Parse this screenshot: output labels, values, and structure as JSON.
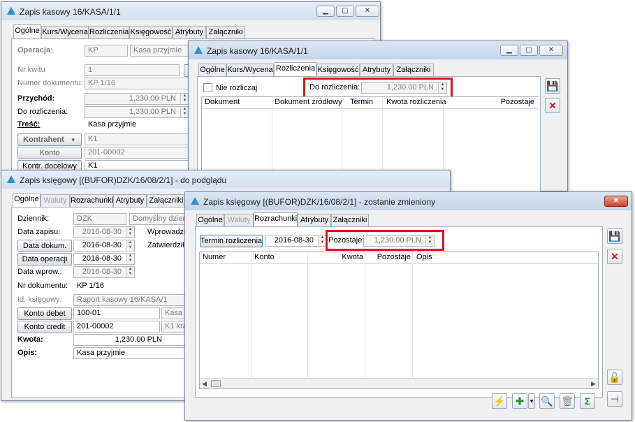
{
  "win1": {
    "title": "Zapis kasowy 16/KASA/1/1",
    "tabs": [
      "Ogólne",
      "Kurs/Wycena",
      "Rozliczenia",
      "Księgowość",
      "Atrybuty",
      "Załączniki"
    ],
    "operacja_label": "Operacja:",
    "operacja_value": "KP",
    "operacja_desc": "Kasa przyjmie",
    "nr_kwitu_label": "Nr kwitu",
    "nr_kwitu_value": "1",
    "nr_dokumentu_label": "Numer dokumentu:",
    "nr_dokumentu_value": "KP 1/16",
    "przychod_label": "Przychód:",
    "przychod_value": "1,230.00 PLN",
    "do_rozliczenia_label": "Do rozliczenia:",
    "do_rozliczenia_value": "1,230.00 PLN",
    "tresc_label": "Treść:",
    "tresc_value": "Kasa przyjmie",
    "kontrahent_button": "Kontrahent",
    "kontrahent_value": "K1",
    "konto_button": "Konto",
    "konto_value": "201-00002",
    "kontr_docelowy_button": "Kontr. docelowy",
    "kontr_docelowy_value": "K1"
  },
  "win2": {
    "title": "Zapis kasowy 16/KASA/1/1",
    "tabs": [
      "Ogólne",
      "Kurs/Wycena",
      "Rozliczenia",
      "Księgowość",
      "Atrybuty",
      "Załączniki"
    ],
    "nie_rozliczaj_label": "Nie rozliczaj",
    "do_rozliczenia_label": "Do rozliczenia:",
    "do_rozliczenia_value": "1,230.00 PLN",
    "columns": [
      "Dokument",
      "Dokument źródłowy",
      "Termin",
      "Kwota rozliczenia",
      "Pozostaje"
    ]
  },
  "win3": {
    "title": "Zapis księgowy [(BUFOR)DZK/16/08/2/1] - do podglądu",
    "tabs": [
      "Ogólne",
      "Waluty",
      "Rozrachunki",
      "Atrybuty",
      "Załączniki"
    ],
    "dziennik_label": "Dziennik:",
    "dziennik_value": "DZK",
    "dziennik_desc": "Domyślny dzienni",
    "data_zapisu_label": "Data zapisu:",
    "data_zapisu_value": "2016-08-30",
    "wprowadzil_label": "Wprowadził:",
    "data_dokum_button": "Data dokum.",
    "data_dokum_value": "2016-08-30",
    "zatwierdzil_label": "Zatwierdził:",
    "data_operacji_button": "Data operacji",
    "data_operacji_value": "2016-08-30",
    "data_wprow_label": "Data wprow.:",
    "data_wprow_value": "2016-08-30",
    "nr_dokumentu_label": "Nr dokumentu:",
    "nr_dokumentu_value": "KP 1/16",
    "id_ksiegowy_label": "Id. księgowy:",
    "id_ksiegowy_value": "Raport kasowy 16/KASA/1",
    "konto_debet_button": "Konto debet",
    "konto_debet_value": "100-01",
    "konto_debet_desc": "Kasa s",
    "konto_credit_button": "Konto credit",
    "konto_credit_value": "201-00002",
    "konto_credit_desc": "K1 kra",
    "kwota_label": "Kwota:",
    "kwota_value": "1,230.00 PLN",
    "opis_label": "Opis:",
    "opis_value": "Kasa przyjmie"
  },
  "win4": {
    "title": "Zapis księgowy [(BUFOR)DZK/16/08/2/1] - zostanie zmieniony",
    "tabs": [
      "Ogólne",
      "Waluty",
      "Rozrachunki",
      "Atrybuty",
      "Załączniki"
    ],
    "termin_button": "Termin rozliczenia",
    "termin_value": "2016-08-30",
    "pozostaje_label": "Pozostaje:",
    "pozostaje_value": "1,230.00 PLN",
    "columns": [
      "Numer",
      "Konto",
      "Kwota",
      "Pozostaje",
      "Opis"
    ]
  },
  "colors": {
    "highlight": "#e0141b",
    "accent": "#2f8fd8"
  }
}
